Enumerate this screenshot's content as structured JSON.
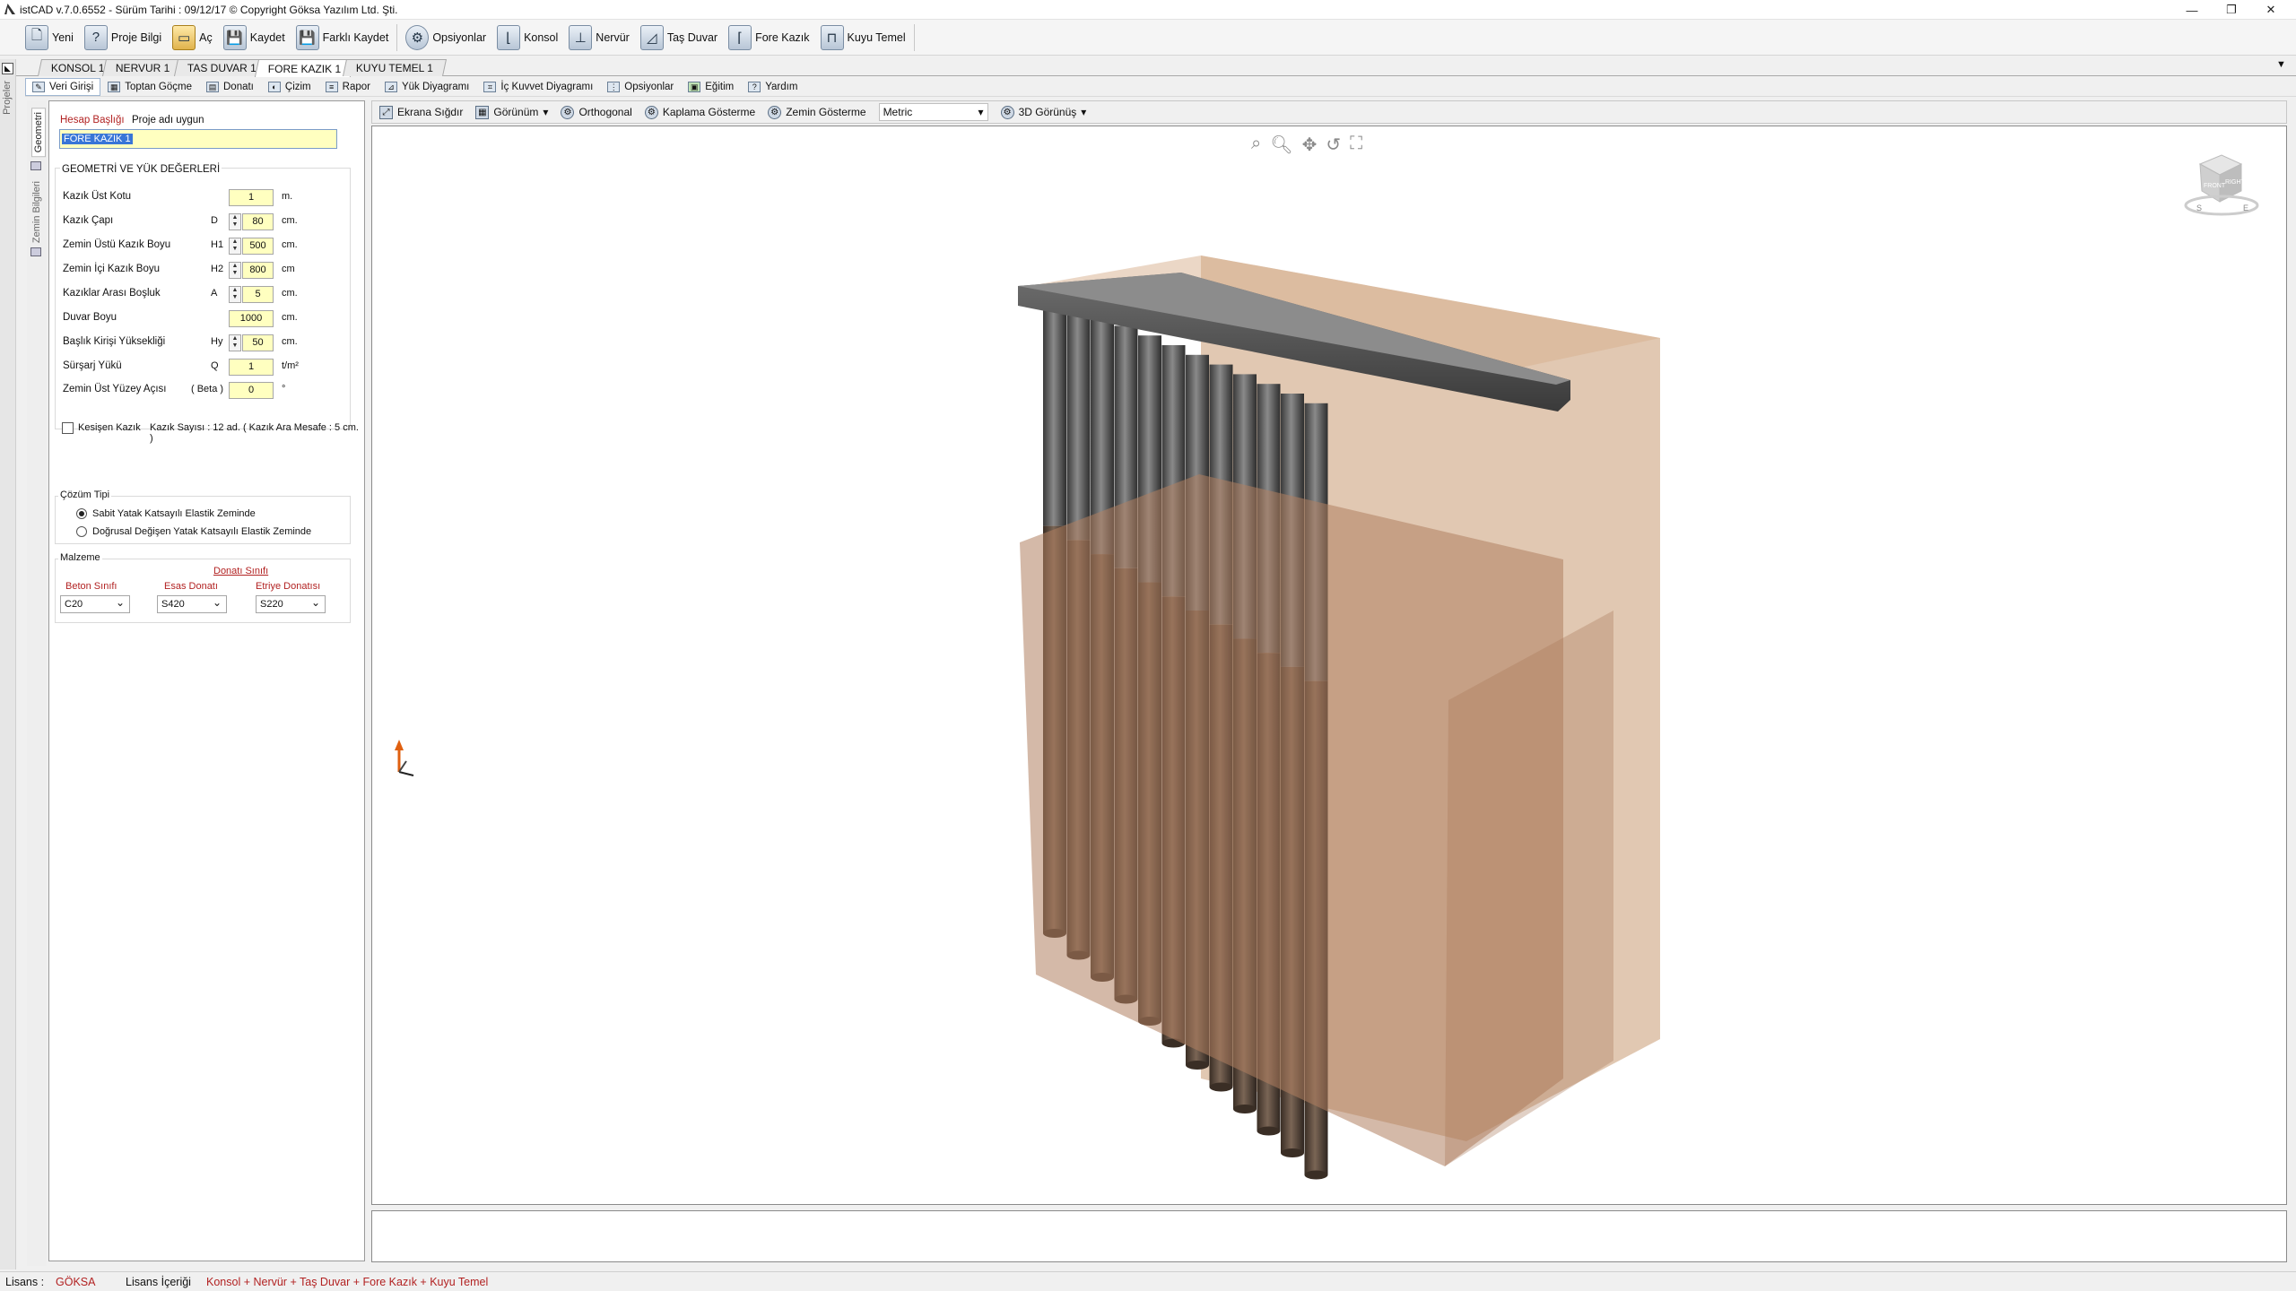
{
  "window": {
    "title": "istCAD v.7.0.6552 -  Sürüm Tarihi : 09/12/17   © Copyright Göksa Yazılım Ltd. Şti.",
    "minimize": "—",
    "restore": "❐",
    "close": "✕"
  },
  "toolbar": {
    "yeni": "Yeni",
    "proje_bilgi": "Proje Bilgi",
    "ac": "Aç",
    "kaydet": "Kaydet",
    "farkli_kaydet": "Farklı Kaydet",
    "opsiyonlar": "Opsiyonlar",
    "konsol": "Konsol",
    "nervur": "Nervür",
    "tas_duvar": "Taş Duvar",
    "fore_kazik": "Fore Kazık",
    "kuyu_temel": "Kuyu Temel"
  },
  "doc_tabs": [
    "KONSOL 1",
    "NERVUR 1",
    "TAS DUVAR 1",
    "FORE KAZIK 1",
    "KUYU TEMEL 1"
  ],
  "sub_tabs": [
    "Veri Girişi",
    "Toptan Göçme",
    "Donatı",
    "Çizim",
    "Rapor",
    "Yük Diyagramı",
    "İç Kuvvet Diyagramı",
    "Opsiyonlar",
    "Eğitim",
    "Yardım"
  ],
  "left_strip": {
    "label": "Projeler"
  },
  "vertical_tabs": [
    "Geometri",
    "Zemin Bilgileri"
  ],
  "form": {
    "hesap_basligi_label": "Hesap Başlığı",
    "proje_adi": "Proje adı uygun",
    "hesap_basligi_value": "FORE KAZIK 1",
    "geometry_title": "GEOMETRİ VE YÜK DEĞERLERİ",
    "rows": [
      {
        "label": "Kazık Üst Kotu",
        "sym": "",
        "value": "1",
        "unit": "m.",
        "spin": false
      },
      {
        "label": "Kazık Çapı",
        "sym": "D",
        "value": "80",
        "unit": "cm.",
        "spin": true
      },
      {
        "label": "Zemin Üstü Kazık Boyu",
        "sym": "H1",
        "value": "500",
        "unit": "cm.",
        "spin": true
      },
      {
        "label": "Zemin İçi Kazık Boyu",
        "sym": "H2",
        "value": "800",
        "unit": "cm",
        "spin": true
      },
      {
        "label": "Kazıklar Arası Boşluk",
        "sym": "A",
        "value": "5",
        "unit": "cm.",
        "spin": true
      },
      {
        "label": "Duvar Boyu",
        "sym": "",
        "value": "1000",
        "unit": "cm.",
        "spin": false
      },
      {
        "label": "Başlık Kirişi Yüksekliği",
        "sym": "Hy",
        "value": "50",
        "unit": "cm.",
        "spin": true
      },
      {
        "label": "Sürşarj Yükü",
        "sym": "Q",
        "value": "1",
        "unit": "t/m²",
        "spin": false
      },
      {
        "label": "Zemin Üst Yüzey Açısı",
        "sym": "( Beta )",
        "value": "0",
        "unit": "°",
        "spin": false
      }
    ],
    "kesisen_kazik": "Kesişen Kazık",
    "kazik_sayisi": "Kazık Sayısı : 12 ad. ( Kazık Ara Mesafe : 5 cm. )",
    "cozum_tipi_title": "Çözüm Tipi",
    "cozum_options": [
      "Sabit Yatak Katsayılı Elastik Zeminde",
      "Doğrusal Değişen Yatak Katsayılı Elastik Zeminde"
    ],
    "malzeme_title": "Malzeme",
    "donati_sinifi": "Donatı Sınıfı",
    "beton_label": "Beton Sınıfı",
    "esas_label": "Esas Donatı",
    "etriye_label": "Etriye Donatısı",
    "beton_value": "C20",
    "esas_value": "S420",
    "etriye_value": "S220"
  },
  "viewbar": {
    "ekrana_sigdir": "Ekrana Sığdır",
    "gorunum": "Görünüm",
    "orthogonal": "Orthogonal",
    "kaplama": "Kaplama Gösterme",
    "zemin": "Zemin Gösterme",
    "units": "Metric",
    "view3d": "3D Görünüş"
  },
  "viewcube": {
    "front": "FRONT",
    "right": "RIGHT",
    "s": "S",
    "e": "E"
  },
  "model": {
    "pile_count": 12
  },
  "status": {
    "lisans_label": "Lisans :",
    "lisans_value": "GÖKSA",
    "icerik_label": "Lisans İçeriği",
    "icerik_value": "Konsol + Nervür + Taş Duvar + Fore Kazık + Kuyu Temel"
  },
  "colors": {
    "accent_red": "#b22222",
    "input_yellow": "#ffffc0",
    "soil": "#c89a72"
  }
}
